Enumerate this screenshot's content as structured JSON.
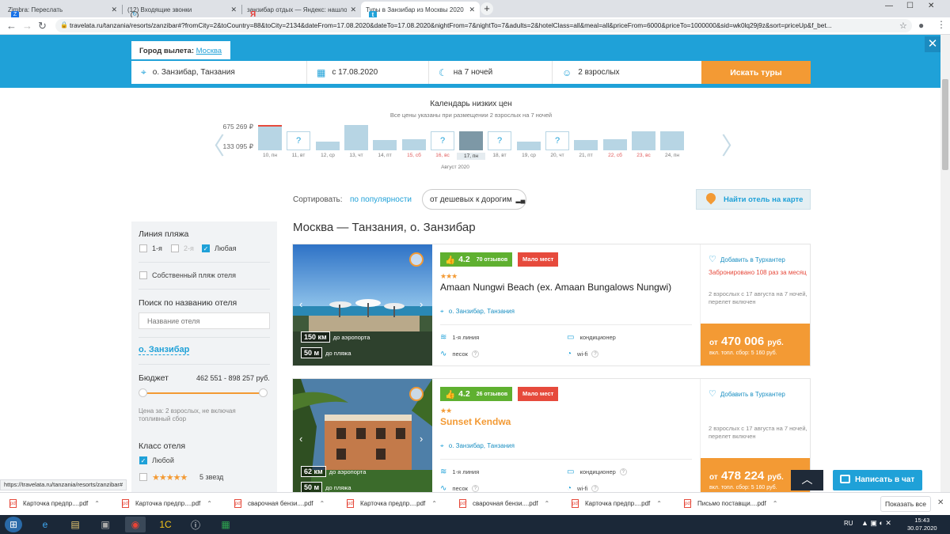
{
  "browser": {
    "tabs": [
      {
        "label": "Zimbra: Переслать",
        "color": "#1a73e8",
        "letter": "Z"
      },
      {
        "label": "(12) Входящие звонки",
        "color": "#555555",
        "letter": "↻"
      },
      {
        "label": "занзибар отдых — Яндекс: нашлось",
        "color": "#e53935",
        "letter": "Я"
      },
      {
        "label": "Туры в Занзибар из Москвы 2020",
        "color": "#1fa1d8",
        "letter": "t"
      }
    ],
    "url": "travelata.ru/tanzania/resorts/zanzibar#?fromCity=2&toCountry=88&toCity=2134&dateFrom=17.08.2020&dateTo=17.08.2020&nightFrom=7&nightTo=7&adults=2&hotelClass=all&meal=all&priceFrom=6000&priceTo=1000000&sid=wk0lq29j9z&sort=priceUp&f_bet..."
  },
  "search": {
    "departure_label": "Город вылета:",
    "departure_city": "Москва",
    "destination": "о. Занзибар, Танзания",
    "date": "с 17.08.2020",
    "nights": "на 7 ночей",
    "guests": "2 взрослых",
    "button": "Искать туры"
  },
  "calendar": {
    "title": "Календарь низких цен",
    "subtitle": "Все цены указаны при размещении 2 взрослых на 7 ночей",
    "max_price": "675 269 ₽",
    "min_price": "133 095 ₽",
    "month": "Август 2020",
    "days": [
      {
        "label": "10, пн",
        "level": 1.0,
        "unknown": false,
        "weekend": false,
        "selected": false
      },
      {
        "label": "11, вт",
        "level": 0,
        "unknown": true,
        "weekend": false,
        "selected": false
      },
      {
        "label": "12, ср",
        "level": 0.2,
        "unknown": false,
        "weekend": false,
        "selected": false
      },
      {
        "label": "13, чт",
        "level": 1.0,
        "unknown": false,
        "weekend": false,
        "selected": false
      },
      {
        "label": "14, пт",
        "level": 0.25,
        "unknown": false,
        "weekend": false,
        "selected": false
      },
      {
        "label": "15, сб",
        "level": 0.3,
        "unknown": false,
        "weekend": true,
        "selected": false
      },
      {
        "label": "16, вс",
        "level": 0,
        "unknown": true,
        "weekend": true,
        "selected": false
      },
      {
        "label": "17, пн",
        "level": 0.7,
        "unknown": false,
        "weekend": false,
        "selected": true
      },
      {
        "label": "18, вт",
        "level": 0,
        "unknown": true,
        "weekend": false,
        "selected": false
      },
      {
        "label": "19, ср",
        "level": 0.2,
        "unknown": false,
        "weekend": false,
        "selected": false
      },
      {
        "label": "20, чт",
        "level": 0,
        "unknown": true,
        "weekend": false,
        "selected": false
      },
      {
        "label": "21, пт",
        "level": 0.25,
        "unknown": false,
        "weekend": false,
        "selected": false
      },
      {
        "label": "22, сб",
        "level": 0.3,
        "unknown": false,
        "weekend": true,
        "selected": false
      },
      {
        "label": "23, вс",
        "level": 0.7,
        "unknown": false,
        "weekend": true,
        "selected": false
      },
      {
        "label": "24, пн",
        "level": 0.7,
        "unknown": false,
        "weekend": false,
        "selected": false
      }
    ]
  },
  "sort": {
    "label": "Сортировать:",
    "popular": "по популярности",
    "cheap": "от дешевых к дорогим",
    "map": "Найти отель на карте"
  },
  "filters": {
    "beach_line_title": "Линия пляжа",
    "line1": "1-я",
    "line2": "2-я",
    "any": "Любая",
    "own_beach": "Собственный пляж отеля",
    "hotel_search_title": "Поиск по названию отеля",
    "hotel_placeholder": "Название отеля",
    "resort": "о. Занзибар",
    "budget_title": "Бюджет",
    "budget_range": "462 551 - 898 257 руб.",
    "budget_low": 0.0,
    "budget_high": 1.0,
    "price_note": "Цена за: 2 взрослых, не включая топливный сбор",
    "class_title": "Класс отеля",
    "class_any": "Любой",
    "class_5": "5 звезд"
  },
  "results": {
    "title": "Москва — Танзания, о. Занзибар",
    "hotels": [
      {
        "rating": "4.2",
        "reviews": "70 отзывов",
        "badge": "Мало мест",
        "stars": "★★★",
        "name": "Amaan Nungwi Beach (ex. Amaan Bungalows Nungwi)",
        "location": "о. Занзибар, Танзания",
        "airport_km": "150 км",
        "airport_label": "до аэропорта",
        "beach_m": "50 м",
        "beach_label": "до пляжа",
        "f1": "1-я линия",
        "f2": "кондиционер",
        "f3": "песок",
        "f4": "wi-fi",
        "favorite": "Добавить в Турхантер",
        "booked": "Забронировано 108 раз за месяц",
        "guests_info": "2 взрослых с 17 августа на 7 ночей, перелет включен",
        "price_from": "от",
        "price": "470 006",
        "currency": "руб.",
        "fee": "вкл. топл. сбор: 5 160 руб."
      },
      {
        "rating": "4.2",
        "reviews": "26 отзывов",
        "badge": "Мало мест",
        "stars": "★★",
        "name": "Sunset Kendwa",
        "location": "о. Занзибар, Танзания",
        "airport_km": "62 км",
        "airport_label": "до аэропорта",
        "beach_m": "50 м",
        "beach_label": "до пляжа",
        "f1": "1-я линия",
        "f2": "кондиционер",
        "f3": "песок",
        "f4": "wi-fi",
        "favorite": "Добавить в Турхантер",
        "booked": "",
        "guests_info": "2 взрослых с 17 августа на 7 ночей, перелет включен",
        "price_from": "от",
        "price": "478 224",
        "currency": "руб.",
        "fee": "вкл. топл. сбор: 5 160 руб."
      }
    ]
  },
  "status_url": "https://travelata.ru/tanzania/resorts/zanzibar#",
  "chat": "Написать в чат",
  "downloads": [
    "Карточка предпр....pdf",
    "Карточка предпр....pdf",
    "сварочная бензи....pdf",
    "Карточка предпр....pdf",
    "сварочная бензи....pdf",
    "Карточка предпр....pdf",
    "Письмо поставщи....pdf"
  ],
  "show_all": "Показать все",
  "taskbar": {
    "lang": "RU",
    "time": "15:43",
    "date": "30.07.2020"
  }
}
